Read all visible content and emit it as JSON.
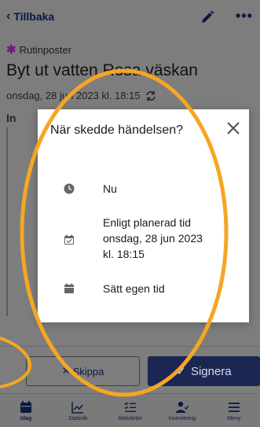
{
  "topbar": {
    "back_label": "Tillbaka",
    "back_icon": "chevron-left-icon",
    "edit_icon": "pencil-icon",
    "more_label": "•••"
  },
  "routine": {
    "category": "Rutinposter",
    "title": "Byt ut vatten Rosa väskan",
    "dateline": "onsdag, 28 jun 2023 kl. 18:15",
    "section_heading_partial": "In"
  },
  "modal": {
    "title": "När skedde händelsen?",
    "close_icon": "close-icon",
    "options": [
      {
        "icon": "clock-icon",
        "label": "Nu"
      },
      {
        "icon": "calendar-check-icon",
        "line1": "Enligt planerad tid",
        "line2": "onsdag, 28 jun 2023",
        "line3": "kl. 18:15"
      },
      {
        "icon": "calendar-icon",
        "label": "Sätt egen tid"
      }
    ]
  },
  "actions": {
    "skip_label": "Skippa",
    "skip_prefix": "✕",
    "sign_label": "Signera",
    "sign_prefix": "✓"
  },
  "tabs": [
    {
      "label": "Idag",
      "icon": "calendar-icon",
      "active": true
    },
    {
      "label": "Statistik",
      "icon": "chart-icon",
      "active": false
    },
    {
      "label": "Aktiviteter",
      "icon": "list-icon",
      "active": false
    },
    {
      "label": "Inventering",
      "icon": "person-check-icon",
      "active": false
    },
    {
      "label": "Meny",
      "icon": "menu-icon",
      "active": false
    }
  ],
  "colors": {
    "navy": "#0b1a44",
    "accent_star": "#6b1f7a",
    "sign_button": "#1b2653",
    "annotation": "#f5a623"
  }
}
